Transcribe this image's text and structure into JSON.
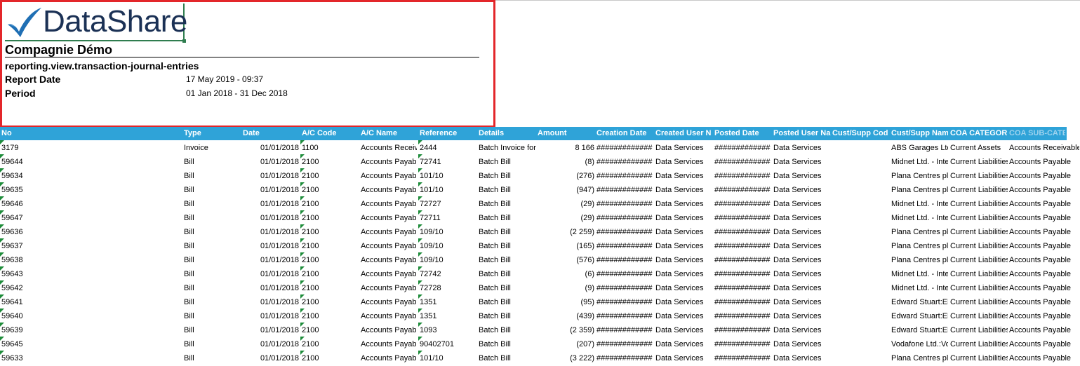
{
  "header": {
    "logo_text": "DataShare",
    "company": "Compagnie Démo",
    "report_name": "reporting.view.transaction-journal-entries",
    "report_date_label": "Report Date",
    "report_date_value": "17 May 2019 - 09:37",
    "period_label": "Period",
    "period_value": "01 Jan 2018 - 31 Dec 2018"
  },
  "colors": {
    "header_border": "#e3262a",
    "table_header_bg": "#2fa3d8",
    "logo_text": "#1b3155",
    "comment_marker": "#1e8c3a"
  },
  "table": {
    "columns": [
      "No",
      "Type",
      "Date",
      "A/C Code",
      "A/C Name",
      "Reference",
      "Details",
      "Amount",
      "Creation Date",
      "Created User N",
      "Posted Date",
      "Posted User Na",
      "Cust/Supp Cod",
      "Cust/Supp Nam",
      "COA CATEGOR",
      "COA SUB-CATEGORY"
    ],
    "rows": [
      [
        "3179",
        "Invoice",
        "01/01/2018",
        "1100",
        "Accounts Receivable",
        "2444",
        "Batch Invoice for",
        "8 166",
        "#############",
        "Data Services",
        "#############",
        "Data Services",
        "",
        "ABS Garages Ltd",
        "Current Assets",
        "Accounts Receivable"
      ],
      [
        "59644",
        "Bill",
        "01/01/2018",
        "2100",
        "Accounts Payable",
        "72741",
        "Batch Bill",
        "(8)",
        "#############",
        "Data Services",
        "#############",
        "Data Services",
        "",
        "Midnet Ltd. - Internet",
        "Current Liabilities",
        "Accounts Payable"
      ],
      [
        "59634",
        "Bill",
        "01/01/2018",
        "2100",
        "Accounts Payable",
        "101/10",
        "Batch Bill",
        "(276)",
        "#############",
        "Data Services",
        "#############",
        "Data Services",
        "",
        "Plana Centres plc",
        "Current Liabilities",
        "Accounts Payable"
      ],
      [
        "59635",
        "Bill",
        "01/01/2018",
        "2100",
        "Accounts Payable",
        "101/10",
        "Batch Bill",
        "(947)",
        "#############",
        "Data Services",
        "#############",
        "Data Services",
        "",
        "Plana Centres plc",
        "Current Liabilities",
        "Accounts Payable"
      ],
      [
        "59646",
        "Bill",
        "01/01/2018",
        "2100",
        "Accounts Payable",
        "72727",
        "Batch Bill",
        "(29)",
        "#############",
        "Data Services",
        "#############",
        "Data Services",
        "",
        "Midnet Ltd. - Internet",
        "Current Liabilities",
        "Accounts Payable"
      ],
      [
        "59647",
        "Bill",
        "01/01/2018",
        "2100",
        "Accounts Payable",
        "72711",
        "Batch Bill",
        "(29)",
        "#############",
        "Data Services",
        "#############",
        "Data Services",
        "",
        "Midnet Ltd. - Internet",
        "Current Liabilities",
        "Accounts Payable"
      ],
      [
        "59636",
        "Bill",
        "01/01/2018",
        "2100",
        "Accounts Payable",
        "109/10",
        "Batch Bill",
        "(2 259)",
        "#############",
        "Data Services",
        "#############",
        "Data Services",
        "",
        "Plana Centres plc",
        "Current Liabilities",
        "Accounts Payable"
      ],
      [
        "59637",
        "Bill",
        "01/01/2018",
        "2100",
        "Accounts Payable",
        "109/10",
        "Batch Bill",
        "(165)",
        "#############",
        "Data Services",
        "#############",
        "Data Services",
        "",
        "Plana Centres plc",
        "Current Liabilities",
        "Accounts Payable"
      ],
      [
        "59638",
        "Bill",
        "01/01/2018",
        "2100",
        "Accounts Payable",
        "109/10",
        "Batch Bill",
        "(576)",
        "#############",
        "Data Services",
        "#############",
        "Data Services",
        "",
        "Plana Centres plc",
        "Current Liabilities",
        "Accounts Payable"
      ],
      [
        "59643",
        "Bill",
        "01/01/2018",
        "2100",
        "Accounts Payable",
        "72742",
        "Batch Bill",
        "(6)",
        "#############",
        "Data Services",
        "#############",
        "Data Services",
        "",
        "Midnet Ltd. - Internet",
        "Current Liabilities",
        "Accounts Payable"
      ],
      [
        "59642",
        "Bill",
        "01/01/2018",
        "2100",
        "Accounts Payable",
        "72728",
        "Batch Bill",
        "(9)",
        "#############",
        "Data Services",
        "#############",
        "Data Services",
        "",
        "Midnet Ltd. - Internet",
        "Current Liabilities",
        "Accounts Payable"
      ],
      [
        "59641",
        "Bill",
        "01/01/2018",
        "2100",
        "Accounts Payable",
        "1351",
        "Batch Bill",
        "(95)",
        "#############",
        "Data Services",
        "#############",
        "Data Services",
        "",
        "Edward Stuart:Electric",
        "Current Liabilities",
        "Accounts Payable"
      ],
      [
        "59640",
        "Bill",
        "01/01/2018",
        "2100",
        "Accounts Payable",
        "1351",
        "Batch Bill",
        "(439)",
        "#############",
        "Data Services",
        "#############",
        "Data Services",
        "",
        "Edward Stuart:Electric",
        "Current Liabilities",
        "Accounts Payable"
      ],
      [
        "59639",
        "Bill",
        "01/01/2018",
        "2100",
        "Accounts Payable",
        "1093",
        "Batch Bill",
        "(2 359)",
        "#############",
        "Data Services",
        "#############",
        "Data Services",
        "",
        "Edward Stuart:Electric",
        "Current Liabilities",
        "Accounts Payable"
      ],
      [
        "59645",
        "Bill",
        "01/01/2018",
        "2100",
        "Accounts Payable",
        "90402701",
        "Batch Bill",
        "(207)",
        "#############",
        "Data Services",
        "#############",
        "Data Services",
        "",
        "Vodafone Ltd.:Vodafone",
        "Current Liabilities",
        "Accounts Payable"
      ],
      [
        "59633",
        "Bill",
        "01/01/2018",
        "2100",
        "Accounts Payable",
        "101/10",
        "Batch Bill",
        "(3 222)",
        "#############",
        "Data Services",
        "#############",
        "Data Services",
        "",
        "Plana Centres plc",
        "Current Liabilities",
        "Accounts Payable"
      ]
    ]
  }
}
